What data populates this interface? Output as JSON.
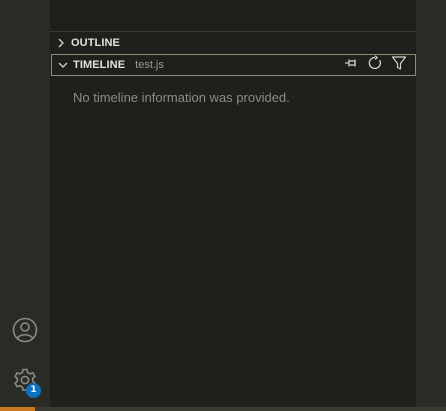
{
  "sidebar": {
    "outline": {
      "title": "OUTLINE",
      "icon": "chevron-right-icon"
    },
    "timeline": {
      "title": "TIMELINE",
      "description": "test.js",
      "icon": "chevron-down-icon",
      "actions": [
        {
          "name": "pin",
          "icon": "pin-icon"
        },
        {
          "name": "refresh",
          "icon": "refresh-icon"
        },
        {
          "name": "filter",
          "icon": "filter-icon"
        }
      ],
      "empty_message": "No timeline information was provided."
    }
  },
  "activity_bar": {
    "accounts_icon": "account-icon",
    "manage_icon": "gear-icon",
    "manage_badge": "1"
  },
  "colors": {
    "badge": "#0e70c0",
    "status_accent": "#c8781e",
    "timeline_border": "#8e8c74"
  }
}
